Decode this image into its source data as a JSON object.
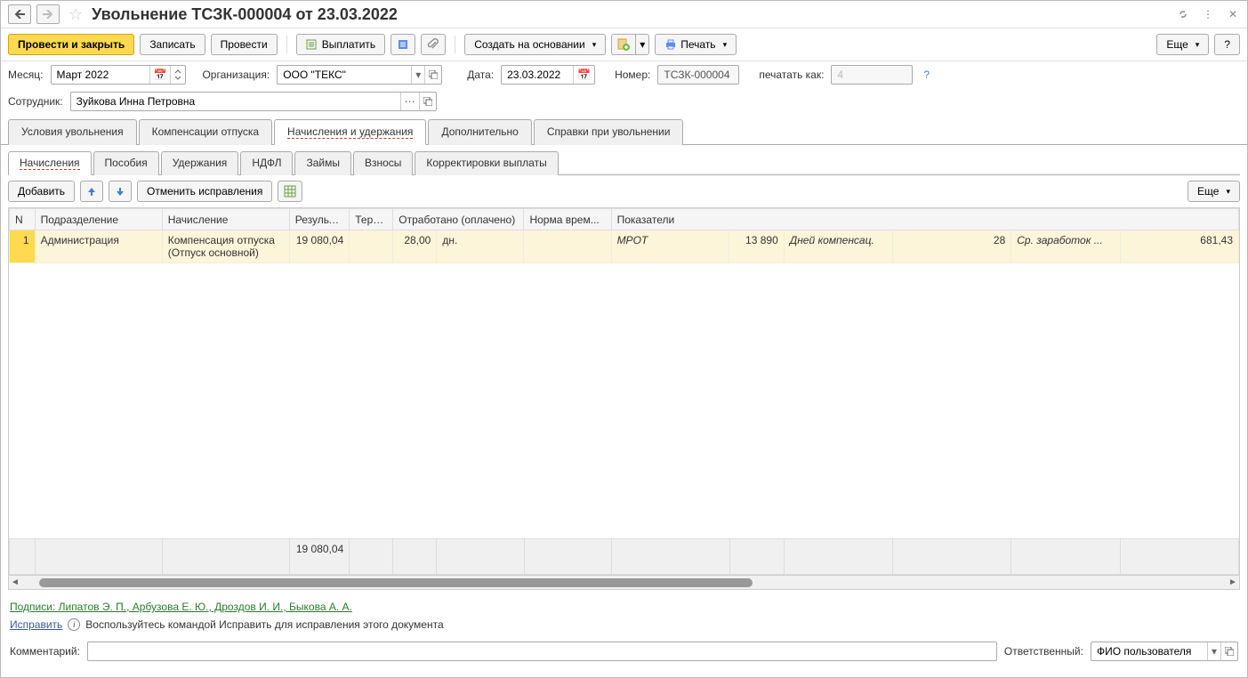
{
  "title": "Увольнение ТСЗК-000004 от 23.03.2022",
  "toolbar": {
    "post_and_close": "Провести и закрыть",
    "save": "Записать",
    "post": "Провести",
    "pay": "Выплатить",
    "create_based": "Создать на основании",
    "print": "Печать",
    "more": "Еще",
    "help": "?"
  },
  "fields": {
    "month_label": "Месяц:",
    "month_value": "Март 2022",
    "org_label": "Организация:",
    "org_value": "ООО \"ТЕКС\"",
    "date_label": "Дата:",
    "date_value": "23.03.2022",
    "number_label": "Номер:",
    "number_value": "ТСЗК-000004",
    "print_as_label": "печатать как:",
    "print_as_value": "4",
    "employee_label": "Сотрудник:",
    "employee_value": "Зуйкова Инна Петровна"
  },
  "main_tabs": [
    "Условия увольнения",
    "Компенсации отпуска",
    "Начисления и удержания",
    "Дополнительно",
    "Справки при увольнении"
  ],
  "main_tab_active": 2,
  "sub_tabs": [
    "Начисления",
    "Пособия",
    "Удержания",
    "НДФЛ",
    "Займы",
    "Взносы",
    "Корректировки выплаты"
  ],
  "sub_tab_active": 0,
  "sub_toolbar": {
    "add": "Добавить",
    "cancel_fix": "Отменить исправления",
    "more": "Еще"
  },
  "table": {
    "columns": [
      "N",
      "Подразделение",
      "Начисление",
      "Результат",
      "Терр...",
      "Отработано (оплачено)",
      "",
      "Норма врем...",
      "Показатели",
      "",
      "",
      "",
      "",
      ""
    ],
    "row": {
      "n": "1",
      "division": "Администрация",
      "accrual_main": "Компенсация отпуска",
      "accrual_sub": "(Отпуск основной)",
      "result": "19 080,04",
      "terr": "",
      "worked_val": "28,00",
      "worked_unit": "дн.",
      "norm": "",
      "ind1_label": "МРОТ",
      "ind1_val": "13 890",
      "ind2_label": "Дней компенсац.",
      "ind2_val": "28",
      "ind3_label": "Ср. заработок ...",
      "ind3_val": "681,43"
    },
    "footer_total": "19 080,04"
  },
  "signatures_label": "Подписи: Липатов Э. П., Арбузова Е. Ю., Дроздов И. И., Быкова А. А.",
  "fix_link": "Исправить",
  "fix_hint": "Воспользуйтесь командой Исправить для исправления этого документа",
  "comment_label": "Комментарий:",
  "responsible_label": "Ответственный:",
  "responsible_value": "ФИО пользователя"
}
